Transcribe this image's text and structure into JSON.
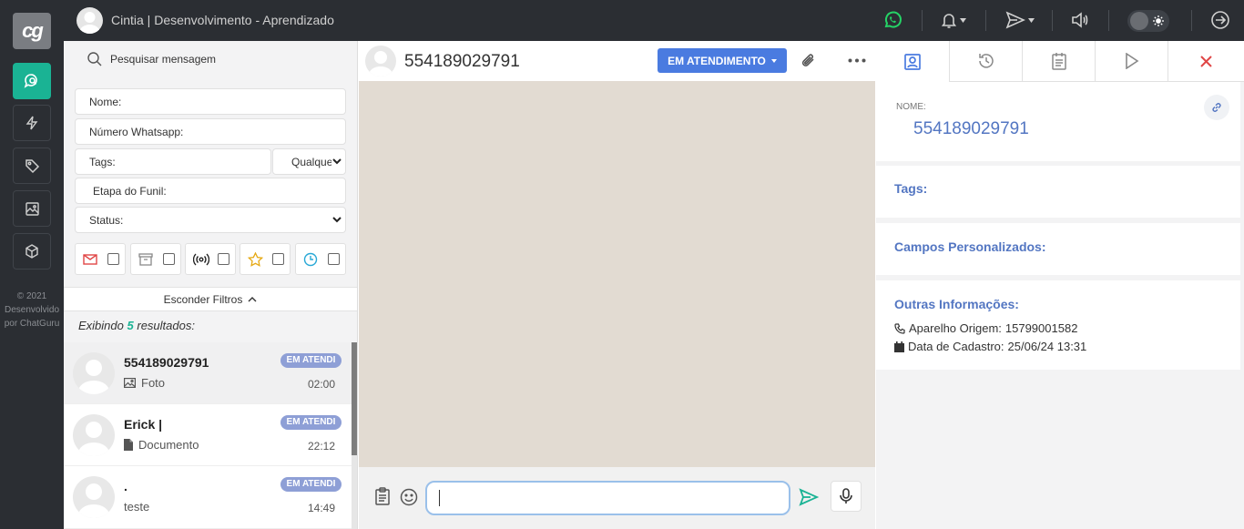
{
  "nav": {
    "logo": "cg",
    "copyright": [
      "© 2021",
      "Desenvolvido",
      "por ChatGuru"
    ],
    "icons": [
      "chat-search-icon",
      "bolt-icon",
      "tag-icon",
      "image-icon",
      "cube-icon"
    ]
  },
  "topbar": {
    "title": "Cintia | Desenvolvimento - Aprendizado"
  },
  "list": {
    "search_placeholder": "Pesquisar mensagem",
    "filters": {
      "name_label": "Nome:",
      "whatsapp_label": "Número Whatsapp:",
      "tags_label": "Tags:",
      "tags_select": "Qualquer",
      "funnel_label": "Etapa do Funil:",
      "status_label": "Status:"
    },
    "hide_filters": "Esconder Filtros",
    "results_prefix": "Exibindo",
    "results_count": "5",
    "results_suffix": "resultados:",
    "chats": [
      {
        "name": "554189029791",
        "preview": "Foto",
        "badge": "EM ATENDI",
        "time": "02:00",
        "preview_icon": "image-icon"
      },
      {
        "name": "Erick |",
        "preview": "Documento",
        "badge": "EM ATENDI",
        "time": "22:12",
        "preview_icon": "document-icon"
      },
      {
        "name": ".",
        "preview": "teste",
        "badge": "EM ATENDI",
        "time": "14:49",
        "preview_icon": ""
      }
    ]
  },
  "conversation": {
    "contact": "554189029791",
    "status_button": "EM ATENDIMENTO"
  },
  "details": {
    "name_label": "NOME:",
    "name_value": "554189029791",
    "tags_label": "Tags:",
    "custom_fields_label": "Campos Personalizados:",
    "other_info_label": "Outras Informações:",
    "device_label": "Aparelho Origem:",
    "device_value": "15799001582",
    "created_label": "Data de Cadastro:",
    "created_value": "25/06/24 13:31"
  },
  "colors": {
    "accent_green": "#1ab394",
    "status_blue": "#4a7be0",
    "label_blue": "#5376c2",
    "badge": "#8e9fd6"
  }
}
